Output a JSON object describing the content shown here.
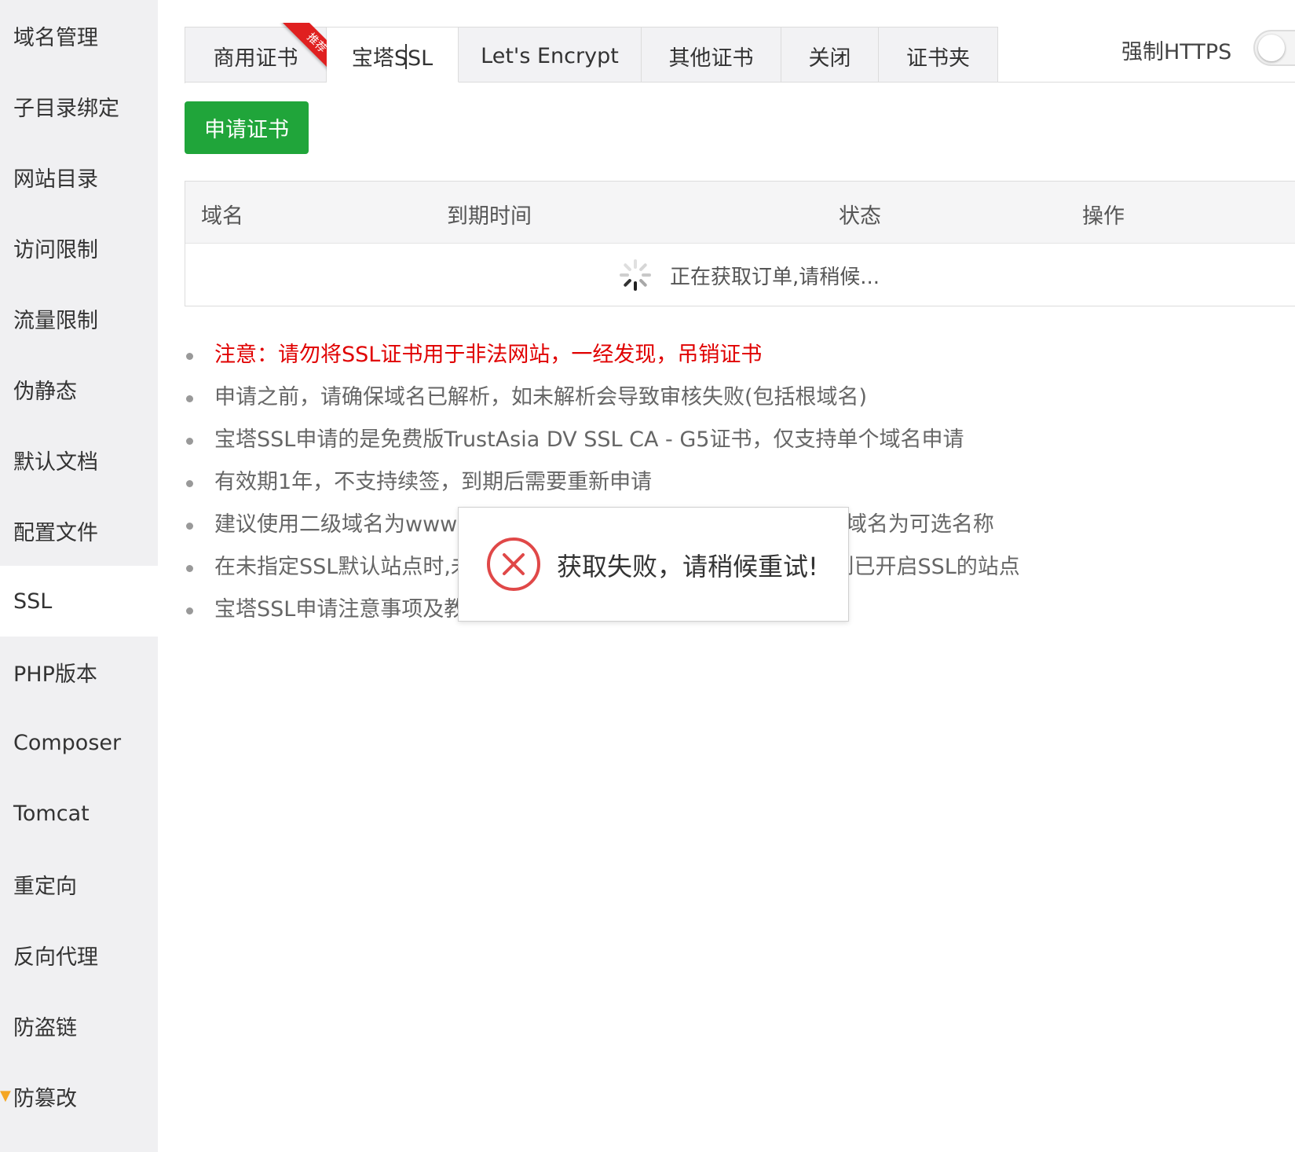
{
  "sidebar": {
    "items": [
      {
        "label": "域名管理"
      },
      {
        "label": "子目录绑定"
      },
      {
        "label": "网站目录"
      },
      {
        "label": "访问限制"
      },
      {
        "label": "流量限制"
      },
      {
        "label": "伪静态"
      },
      {
        "label": "默认文档"
      },
      {
        "label": "配置文件"
      },
      {
        "label": "SSL",
        "active": true
      },
      {
        "label": "PHP版本"
      },
      {
        "label": "Composer"
      },
      {
        "label": "Tomcat"
      },
      {
        "label": "重定向"
      },
      {
        "label": "反向代理"
      },
      {
        "label": "防盗链"
      },
      {
        "label": "防篡改"
      }
    ]
  },
  "tabs": [
    {
      "label": "商用证书",
      "badge": "推荐"
    },
    {
      "label": "宝塔SSL",
      "active": true
    },
    {
      "label": "Let's Encrypt"
    },
    {
      "label": "其他证书"
    },
    {
      "label": "关闭"
    },
    {
      "label": "证书夹"
    }
  ],
  "force_https": {
    "label": "强制HTTPS",
    "enabled": false
  },
  "apply_button": {
    "label": "申请证书"
  },
  "table": {
    "columns": [
      "域名",
      "到期时间",
      "状态",
      "操作"
    ],
    "loading_text": "正在获取订单,请稍候..."
  },
  "notes": [
    "注意：请勿将SSL证书用于非法网站，一经发现，吊销证书",
    "申请之前，请确保域名已解析，如未解析会导致审核失败(包括根域名)",
    "宝塔SSL申请的是免费版TrustAsia DV SSL CA - G5证书，仅支持单个域名申请",
    "有效期1年，不支持续签，到期后需要重新申请",
    "建议使用二级域名为www的域名申请证书,此时系统会默认赠送顶级域名为可选名称",
    "在未指定SSL默认站点时,未开启SSL的站点使用HTTPS会直接访问到已开启SSL的站点",
    "宝塔SSL申请注意事项及教程"
  ],
  "dialog": {
    "message": "获取失败，请稍候重试!"
  },
  "colors": {
    "primary_green": "#20a53a",
    "warning_red": "#e00000",
    "ribbon_red": "#e02020",
    "error_icon_red": "#e04848"
  }
}
